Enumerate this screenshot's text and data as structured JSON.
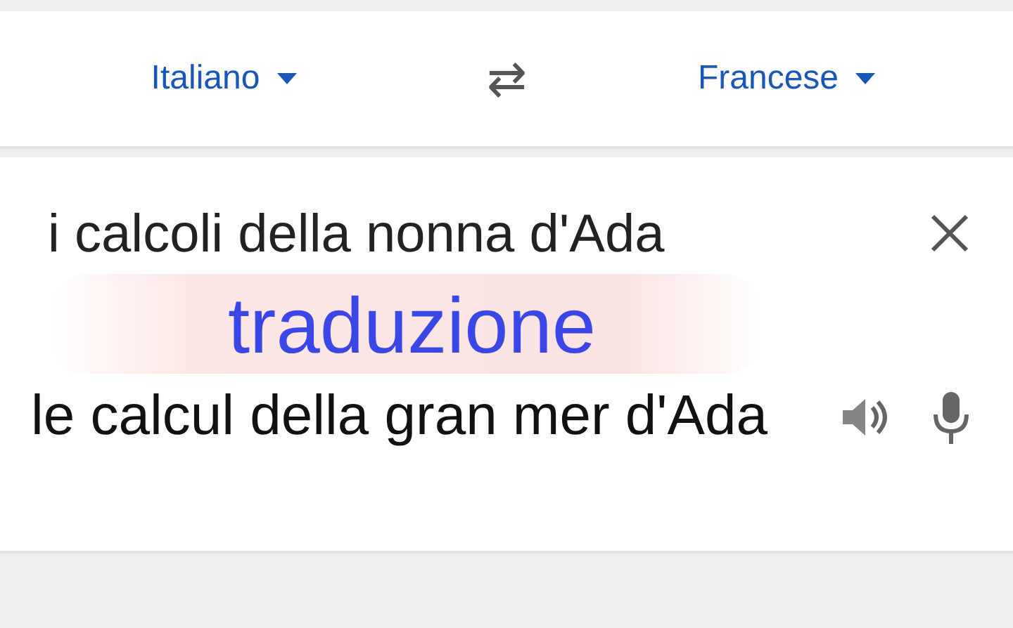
{
  "languages": {
    "source": "Italiano",
    "swap": "⇄",
    "target": "Francese"
  },
  "input": {
    "text": "i calcoli della nonna d'Ada"
  },
  "overlay": {
    "text": "traduzione"
  },
  "output": {
    "text": "le calcul della gran mer d'Ada"
  }
}
